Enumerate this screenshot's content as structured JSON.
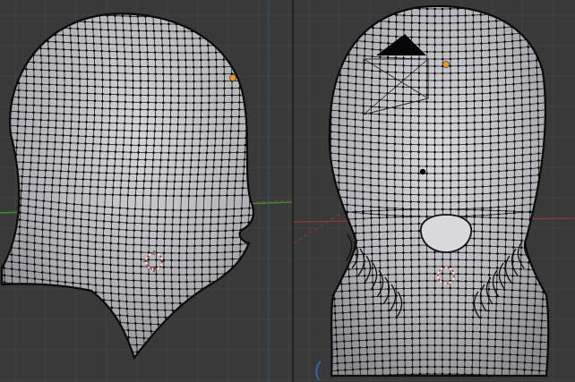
{
  "viewports": [
    {
      "id": "side-view",
      "object": "head-mesh",
      "view": "side",
      "colors": {
        "background": "#393939",
        "grid": "#4a4a4a",
        "axis_x": "#8c3a3a",
        "axis_y": "#3c8a2e",
        "axis_z": "#3a5fa8"
      }
    },
    {
      "id": "front-view",
      "object": "head-mesh",
      "view": "front",
      "colors": {
        "background": "#393939",
        "grid": "#4a4a4a",
        "axis_x": "#8c3a3a",
        "axis_y": "#3c8a2e",
        "axis_z": "#3a5fa8"
      }
    }
  ],
  "mesh": {
    "surface": "#b9b9bc",
    "wire": "#101010",
    "vertex": "#000000"
  },
  "objects": {
    "lamp": {
      "icon": "lamp-origin-icon",
      "color": "#e89a2c"
    },
    "camera": {
      "icon": "camera-icon",
      "color": "#000000"
    },
    "cursor": {
      "icon": "3d-cursor-icon",
      "colors": [
        "#c43a3a",
        "#ffffff"
      ]
    }
  }
}
